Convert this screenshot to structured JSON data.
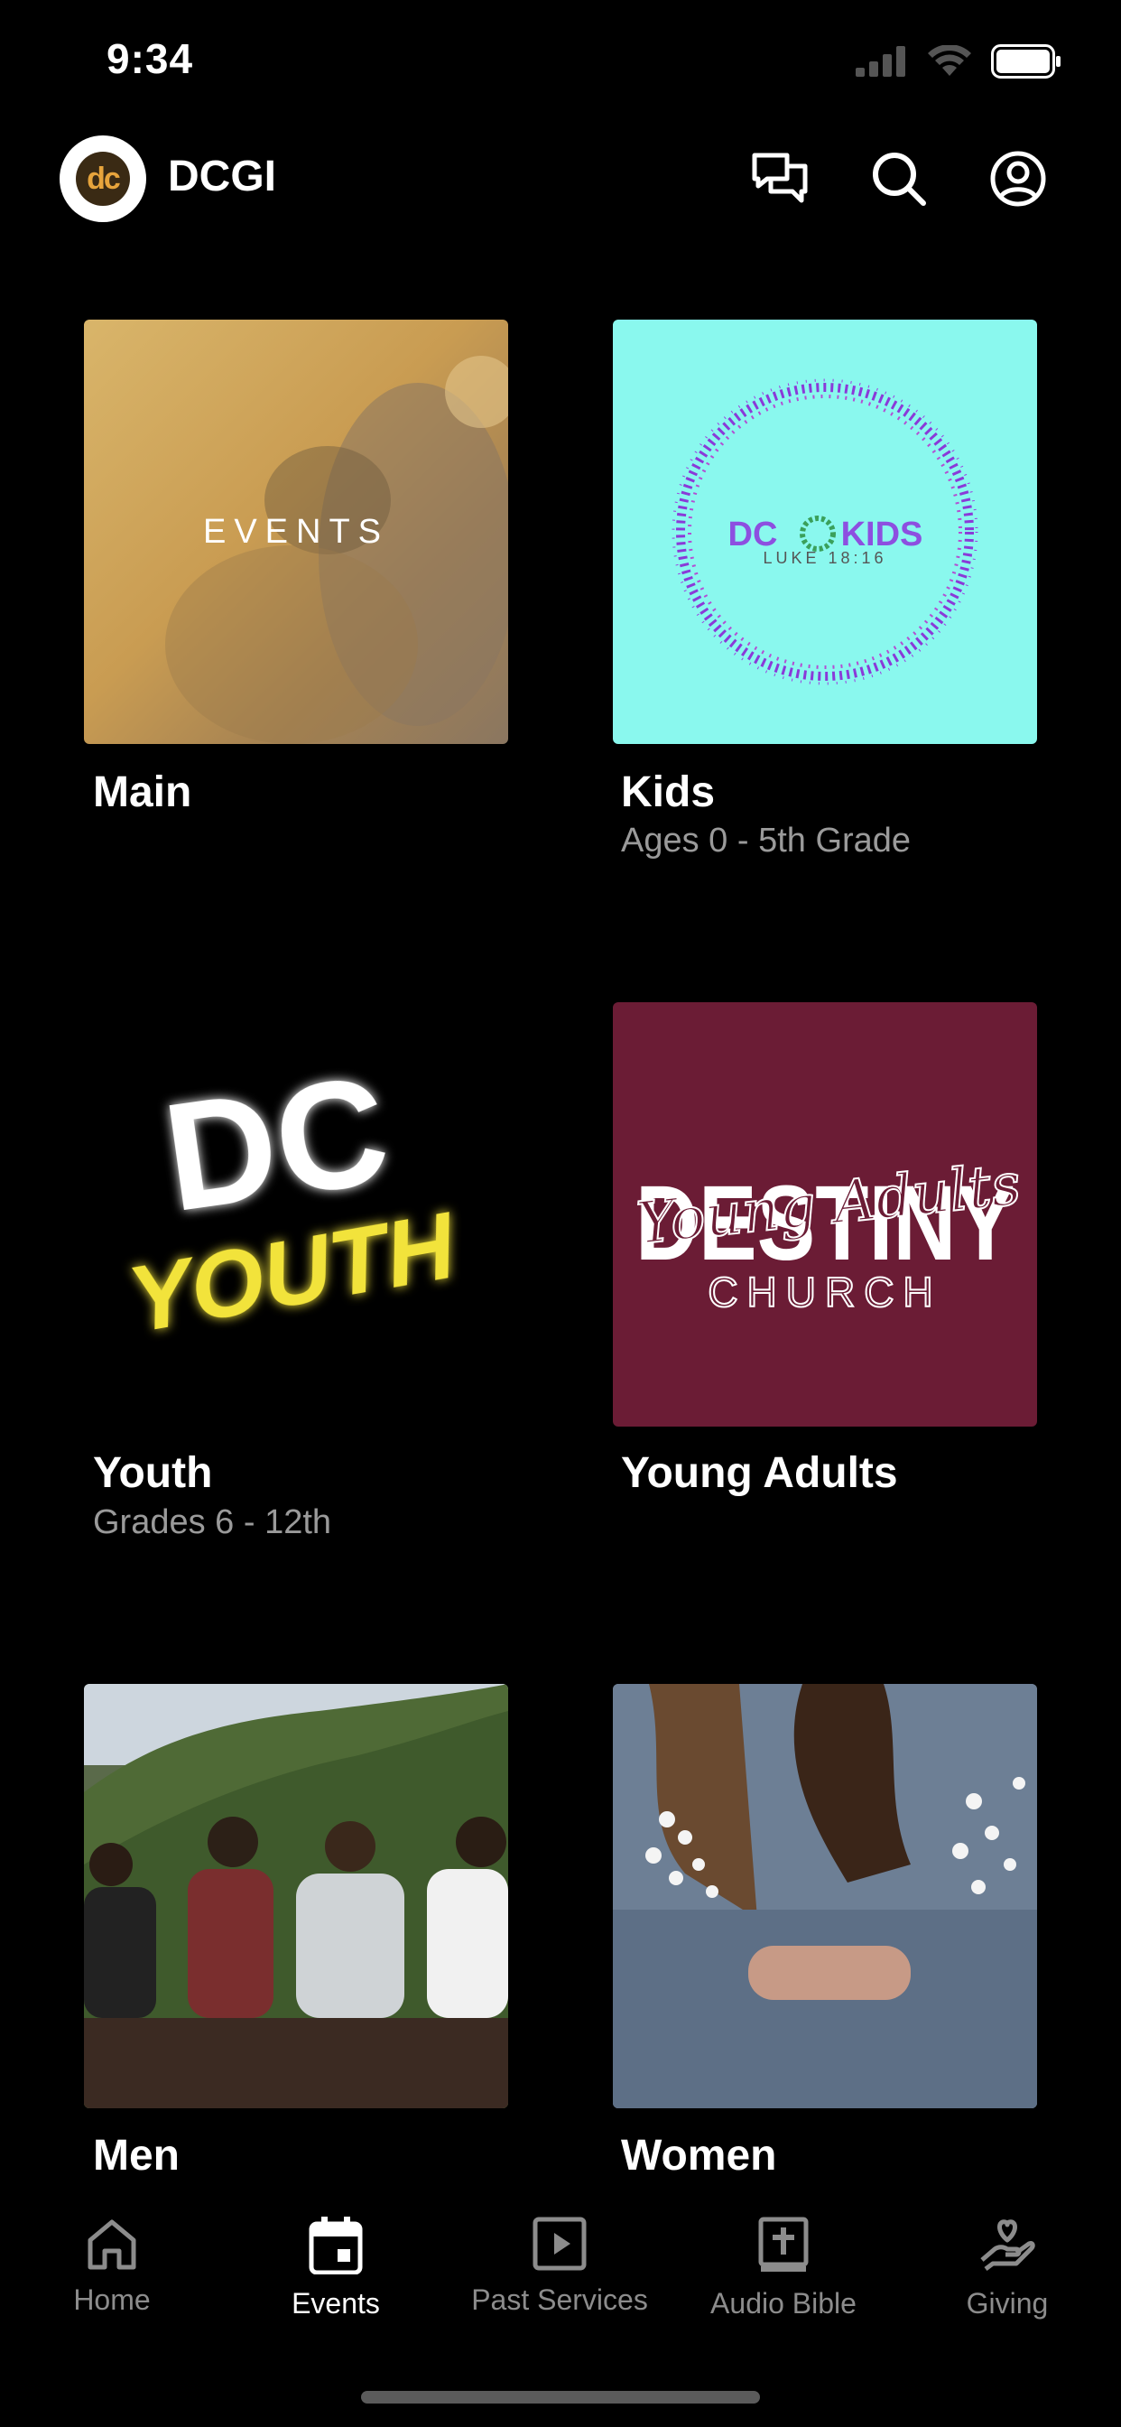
{
  "status": {
    "time": "9:34"
  },
  "header": {
    "title": "DCGI",
    "logo_text": "dc"
  },
  "tiles": [
    {
      "label": "Main",
      "subtitle": "",
      "image_text": "EVENTS"
    },
    {
      "label": "Kids",
      "subtitle": "Ages 0 - 5th Grade",
      "image_text_a": "DC",
      "image_text_b": "KIDS",
      "image_text_c": "LUKE 18:16"
    },
    {
      "label": "Youth",
      "subtitle": "Grades 6 - 12th",
      "image_text_a": "DC",
      "image_text_b": "YOUTH"
    },
    {
      "label": "Young Adults",
      "subtitle": "",
      "image_text_a": "DESTINY",
      "image_text_b": "Young Adults",
      "image_text_c": "CHURCH"
    },
    {
      "label": "Men",
      "subtitle": ""
    },
    {
      "label": "Women",
      "subtitle": ""
    }
  ],
  "tabs": [
    {
      "label": "Home",
      "icon": "home-icon"
    },
    {
      "label": "Events",
      "icon": "calendar-icon",
      "active": true
    },
    {
      "label": "Past Services",
      "icon": "play-icon"
    },
    {
      "label": "Audio Bible",
      "icon": "bible-icon"
    },
    {
      "label": "Giving",
      "icon": "giving-icon"
    }
  ],
  "colors": {
    "background": "#000000",
    "kids_bg": "#8af8ee",
    "young_adults_bg": "#6b1c35",
    "events_tint": "#c9a05a"
  }
}
